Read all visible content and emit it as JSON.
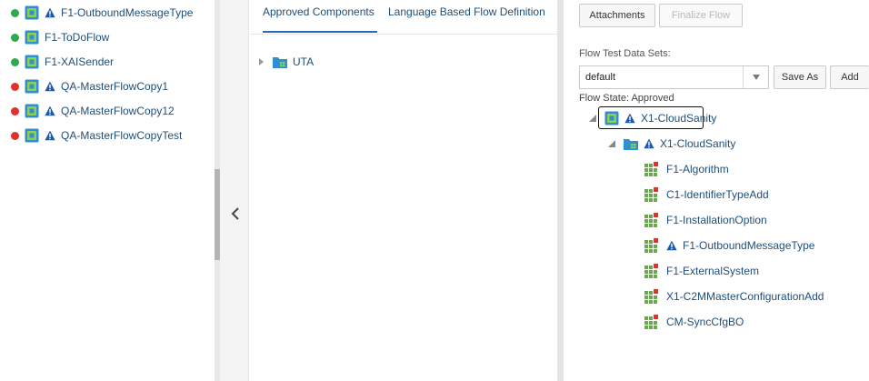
{
  "flow_list": {
    "items": [
      {
        "status": "green",
        "warning": true,
        "label": "F1-OutboundMessageType"
      },
      {
        "status": "green",
        "warning": false,
        "label": "F1-ToDoFlow"
      },
      {
        "status": "green",
        "warning": false,
        "label": "F1-XAISender"
      },
      {
        "status": "red",
        "warning": true,
        "label": "QA-MasterFlowCopy1"
      },
      {
        "status": "red",
        "warning": true,
        "label": "QA-MasterFlowCopy12"
      },
      {
        "status": "red",
        "warning": true,
        "label": "QA-MasterFlowCopyTest"
      }
    ]
  },
  "middle": {
    "tabs": [
      {
        "label": "Approved Components",
        "active": true
      },
      {
        "label": "Language Based Flow Definition",
        "active": false
      }
    ],
    "tree": {
      "label": "UTA"
    }
  },
  "right": {
    "buttons": {
      "attachments": "Attachments",
      "finalize": "Finalize Flow",
      "save_as": "Save As",
      "add": "Add"
    },
    "datasets_label": "Flow Test Data Sets:",
    "datasets_value": "default",
    "state_label": "Flow State: Approved",
    "tree": {
      "root": "X1-CloudSanity",
      "child": "X1-CloudSanity",
      "leaves": [
        {
          "label": "F1-Algorithm",
          "warning": false
        },
        {
          "label": "C1-IdentifierTypeAdd",
          "warning": false
        },
        {
          "label": "F1-InstallationOption",
          "warning": false
        },
        {
          "label": "F1-OutboundMessageType",
          "warning": true
        },
        {
          "label": "F1-ExternalSystem",
          "warning": false
        },
        {
          "label": "X1-C2MMasterConfigurationAdd",
          "warning": false
        },
        {
          "label": "CM-SyncCfgBO",
          "warning": false
        }
      ]
    }
  },
  "colors": {
    "green": "#2fa84f",
    "red": "#e0312a",
    "link": "#1f4e79",
    "warning": "#1e5aa8",
    "component": "#6aa84f"
  }
}
